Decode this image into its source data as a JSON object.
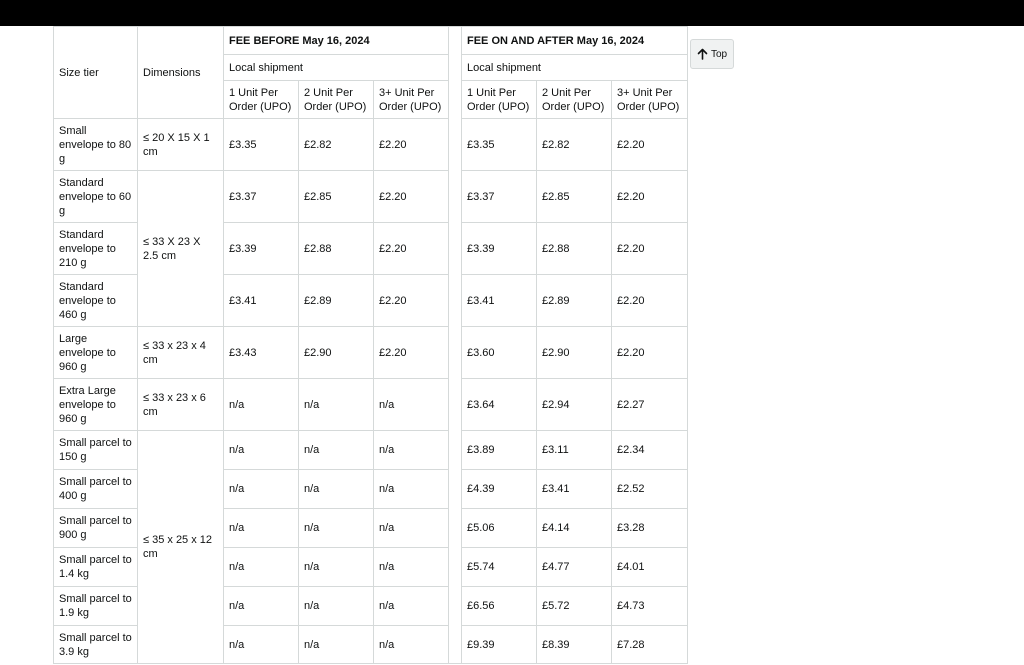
{
  "header": {
    "size_tier": "Size tier",
    "dimensions": "Dimensions",
    "fee_before": "FEE BEFORE May 16, 2024",
    "fee_after": "FEE ON AND AFTER May 16, 2024",
    "local_shipment_before": "Local shipment",
    "local_shipment_after": "Local shipment",
    "upo_cols_before": [
      "1 Unit Per Order (UPO)",
      "2 Unit Per Order (UPO)",
      "3+ Unit Per Order (UPO)"
    ],
    "upo_cols_after": [
      "1 Unit Per Order (UPO)",
      "2 Unit Per Order (UPO)",
      "3+ Unit Per Order (UPO)"
    ]
  },
  "dimension_groups": [
    "≤ 20 X 15 X 1 cm",
    "≤ 33 X 23 X 2.5 cm",
    "≤ 33 x 23 x 4 cm",
    "≤ 33 x 23 x 6 cm",
    "≤ 35 x 25 x 12 cm"
  ],
  "rows": [
    {
      "tier": "Small envelope to 80 g",
      "before": [
        "£3.35",
        "£2.82",
        "£2.20"
      ],
      "after": [
        "£3.35",
        "£2.82",
        "£2.20"
      ]
    },
    {
      "tier": "Standard envelope to 60 g",
      "before": [
        "£3.37",
        "£2.85",
        "£2.20"
      ],
      "after": [
        "£3.37",
        "£2.85",
        "£2.20"
      ]
    },
    {
      "tier": "Standard envelope to 210 g",
      "before": [
        "£3.39",
        "£2.88",
        "£2.20"
      ],
      "after": [
        "£3.39",
        "£2.88",
        "£2.20"
      ]
    },
    {
      "tier": "Standard envelope to 460 g",
      "before": [
        "£3.41",
        "£2.89",
        "£2.20"
      ],
      "after": [
        "£3.41",
        "£2.89",
        "£2.20"
      ]
    },
    {
      "tier": "Large envelope to 960 g",
      "before": [
        "£3.43",
        "£2.90",
        "£2.20"
      ],
      "after": [
        "£3.60",
        "£2.90",
        "£2.20"
      ]
    },
    {
      "tier": "Extra Large envelope to 960 g",
      "before": [
        "n/a",
        "n/a",
        "n/a"
      ],
      "after": [
        "£3.64",
        "£2.94",
        "£2.27"
      ]
    },
    {
      "tier": "Small parcel to 150 g",
      "before": [
        "n/a",
        "n/a",
        "n/a"
      ],
      "after": [
        "£3.89",
        "£3.11",
        "£2.34"
      ]
    },
    {
      "tier": "Small parcel to 400 g",
      "before": [
        "n/a",
        "n/a",
        "n/a"
      ],
      "after": [
        "£4.39",
        "£3.41",
        "£2.52"
      ]
    },
    {
      "tier": "Small parcel to 900 g",
      "before": [
        "n/a",
        "n/a",
        "n/a"
      ],
      "after": [
        "£5.06",
        "£4.14",
        "£3.28"
      ]
    },
    {
      "tier": "Small parcel to 1.4 kg",
      "before": [
        "n/a",
        "n/a",
        "n/a"
      ],
      "after": [
        "£5.74",
        "£4.77",
        "£4.01"
      ]
    },
    {
      "tier": "Small parcel to 1.9 kg",
      "before": [
        "n/a",
        "n/a",
        "n/a"
      ],
      "after": [
        "£6.56",
        "£5.72",
        "£4.73"
      ]
    },
    {
      "tier": "Small parcel to 3.9 kg",
      "before": [
        "n/a",
        "n/a",
        "n/a"
      ],
      "after": [
        "£9.39",
        "£8.39",
        "£7.28"
      ]
    }
  ],
  "top_button": {
    "label": "Top",
    "icon": "arrow-up-icon"
  }
}
